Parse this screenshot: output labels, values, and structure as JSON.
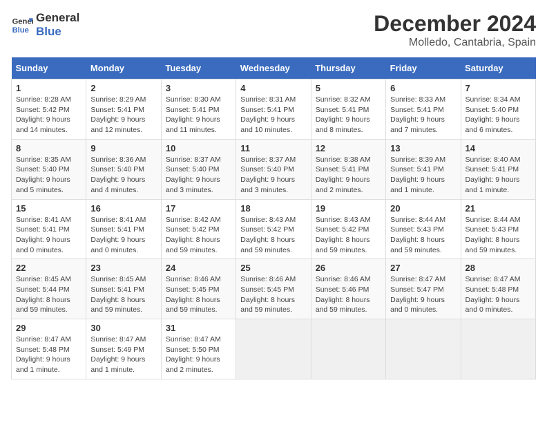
{
  "header": {
    "logo_line1": "General",
    "logo_line2": "Blue",
    "month": "December 2024",
    "location": "Molledo, Cantabria, Spain"
  },
  "days_of_week": [
    "Sunday",
    "Monday",
    "Tuesday",
    "Wednesday",
    "Thursday",
    "Friday",
    "Saturday"
  ],
  "weeks": [
    [
      {
        "day": "1",
        "sunrise": "8:28 AM",
        "sunset": "5:42 PM",
        "daylight": "9 hours and 14 minutes."
      },
      {
        "day": "2",
        "sunrise": "8:29 AM",
        "sunset": "5:41 PM",
        "daylight": "9 hours and 12 minutes."
      },
      {
        "day": "3",
        "sunrise": "8:30 AM",
        "sunset": "5:41 PM",
        "daylight": "9 hours and 11 minutes."
      },
      {
        "day": "4",
        "sunrise": "8:31 AM",
        "sunset": "5:41 PM",
        "daylight": "9 hours and 10 minutes."
      },
      {
        "day": "5",
        "sunrise": "8:32 AM",
        "sunset": "5:41 PM",
        "daylight": "9 hours and 8 minutes."
      },
      {
        "day": "6",
        "sunrise": "8:33 AM",
        "sunset": "5:41 PM",
        "daylight": "9 hours and 7 minutes."
      },
      {
        "day": "7",
        "sunrise": "8:34 AM",
        "sunset": "5:40 PM",
        "daylight": "9 hours and 6 minutes."
      }
    ],
    [
      {
        "day": "8",
        "sunrise": "8:35 AM",
        "sunset": "5:40 PM",
        "daylight": "9 hours and 5 minutes."
      },
      {
        "day": "9",
        "sunrise": "8:36 AM",
        "sunset": "5:40 PM",
        "daylight": "9 hours and 4 minutes."
      },
      {
        "day": "10",
        "sunrise": "8:37 AM",
        "sunset": "5:40 PM",
        "daylight": "9 hours and 3 minutes."
      },
      {
        "day": "11",
        "sunrise": "8:37 AM",
        "sunset": "5:40 PM",
        "daylight": "9 hours and 3 minutes."
      },
      {
        "day": "12",
        "sunrise": "8:38 AM",
        "sunset": "5:41 PM",
        "daylight": "9 hours and 2 minutes."
      },
      {
        "day": "13",
        "sunrise": "8:39 AM",
        "sunset": "5:41 PM",
        "daylight": "9 hours and 1 minute."
      },
      {
        "day": "14",
        "sunrise": "8:40 AM",
        "sunset": "5:41 PM",
        "daylight": "9 hours and 1 minute."
      }
    ],
    [
      {
        "day": "15",
        "sunrise": "8:41 AM",
        "sunset": "5:41 PM",
        "daylight": "9 hours and 0 minutes."
      },
      {
        "day": "16",
        "sunrise": "8:41 AM",
        "sunset": "5:41 PM",
        "daylight": "9 hours and 0 minutes."
      },
      {
        "day": "17",
        "sunrise": "8:42 AM",
        "sunset": "5:42 PM",
        "daylight": "8 hours and 59 minutes."
      },
      {
        "day": "18",
        "sunrise": "8:43 AM",
        "sunset": "5:42 PM",
        "daylight": "8 hours and 59 minutes."
      },
      {
        "day": "19",
        "sunrise": "8:43 AM",
        "sunset": "5:42 PM",
        "daylight": "8 hours and 59 minutes."
      },
      {
        "day": "20",
        "sunrise": "8:44 AM",
        "sunset": "5:43 PM",
        "daylight": "8 hours and 59 minutes."
      },
      {
        "day": "21",
        "sunrise": "8:44 AM",
        "sunset": "5:43 PM",
        "daylight": "8 hours and 59 minutes."
      }
    ],
    [
      {
        "day": "22",
        "sunrise": "8:45 AM",
        "sunset": "5:44 PM",
        "daylight": "8 hours and 59 minutes."
      },
      {
        "day": "23",
        "sunrise": "8:45 AM",
        "sunset": "5:41 PM",
        "daylight": "8 hours and 59 minutes."
      },
      {
        "day": "24",
        "sunrise": "8:46 AM",
        "sunset": "5:45 PM",
        "daylight": "8 hours and 59 minutes."
      },
      {
        "day": "25",
        "sunrise": "8:46 AM",
        "sunset": "5:45 PM",
        "daylight": "8 hours and 59 minutes."
      },
      {
        "day": "26",
        "sunrise": "8:46 AM",
        "sunset": "5:46 PM",
        "daylight": "8 hours and 59 minutes."
      },
      {
        "day": "27",
        "sunrise": "8:47 AM",
        "sunset": "5:47 PM",
        "daylight": "9 hours and 0 minutes."
      },
      {
        "day": "28",
        "sunrise": "8:47 AM",
        "sunset": "5:48 PM",
        "daylight": "9 hours and 0 minutes."
      }
    ],
    [
      {
        "day": "29",
        "sunrise": "8:47 AM",
        "sunset": "5:48 PM",
        "daylight": "9 hours and 1 minute."
      },
      {
        "day": "30",
        "sunrise": "8:47 AM",
        "sunset": "5:49 PM",
        "daylight": "9 hours and 1 minute."
      },
      {
        "day": "31",
        "sunrise": "8:47 AM",
        "sunset": "5:50 PM",
        "daylight": "9 hours and 2 minutes."
      },
      null,
      null,
      null,
      null
    ]
  ],
  "labels": {
    "sunrise": "Sunrise:",
    "sunset": "Sunset:",
    "daylight": "Daylight:"
  }
}
